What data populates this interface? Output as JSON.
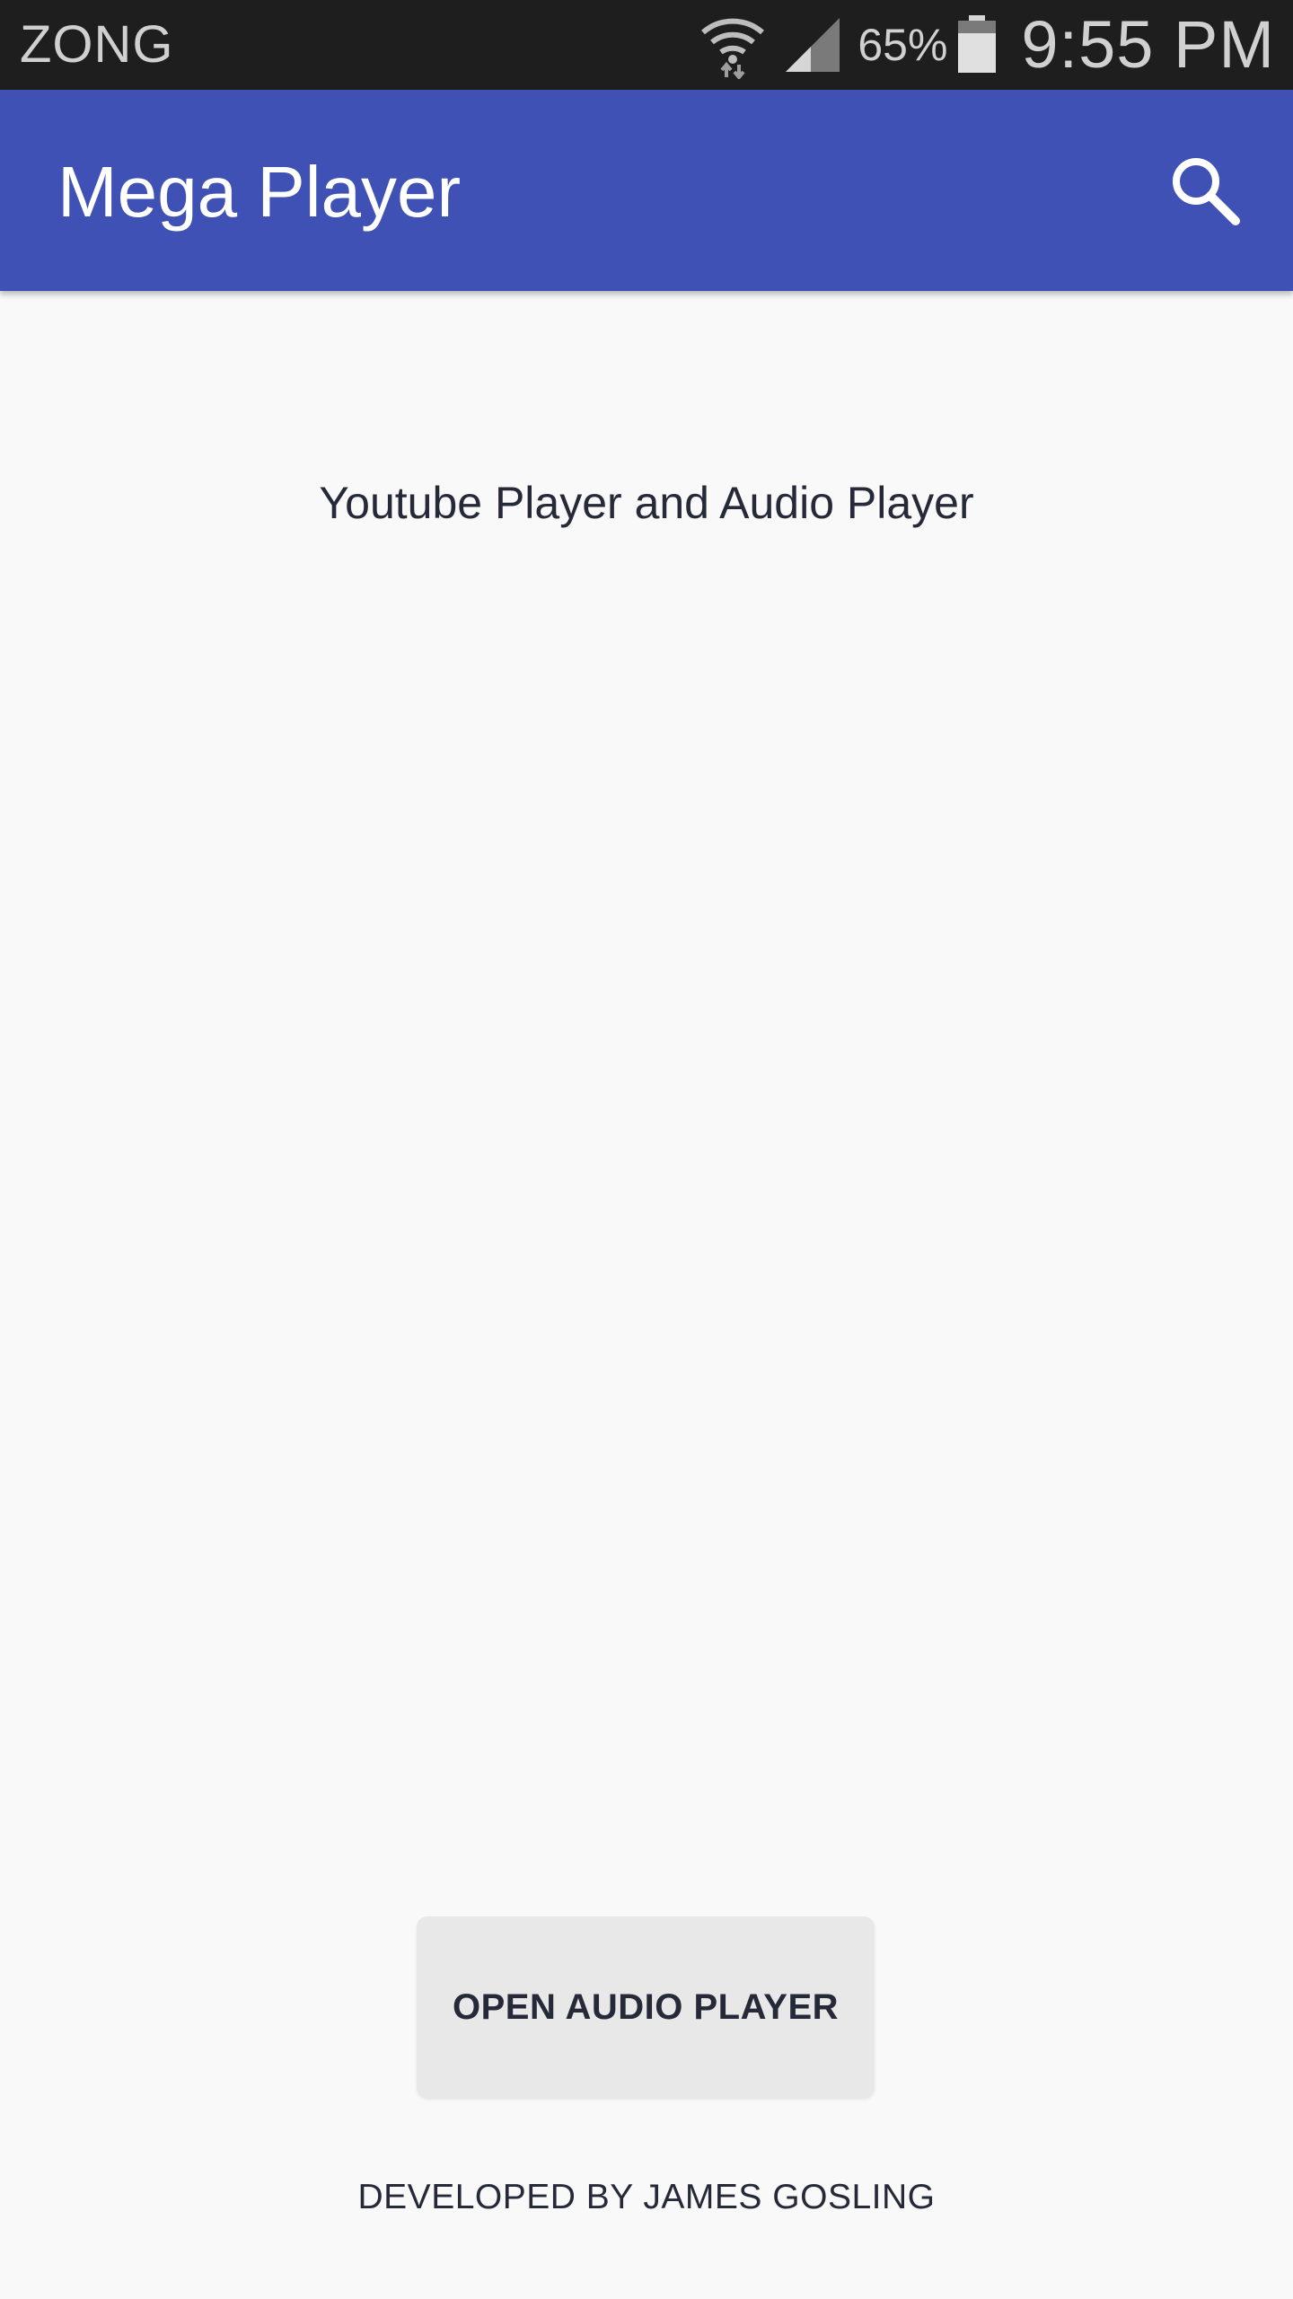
{
  "status_bar": {
    "carrier": "ZONG",
    "battery_percent": "65%",
    "battery_level": 0.65,
    "time": "9:55 PM",
    "icons": [
      "wifi-icon",
      "cell-signal-icon",
      "battery-icon"
    ]
  },
  "app_bar": {
    "title": "Mega Player",
    "background_color": "#3f51b5",
    "actions": [
      "search-icon"
    ]
  },
  "main": {
    "headline": "Youtube Player and Audio Player",
    "open_button_label": "OPEN AUDIO PLAYER",
    "footer": "DEVELOPED BY JAMES GOSLING"
  }
}
